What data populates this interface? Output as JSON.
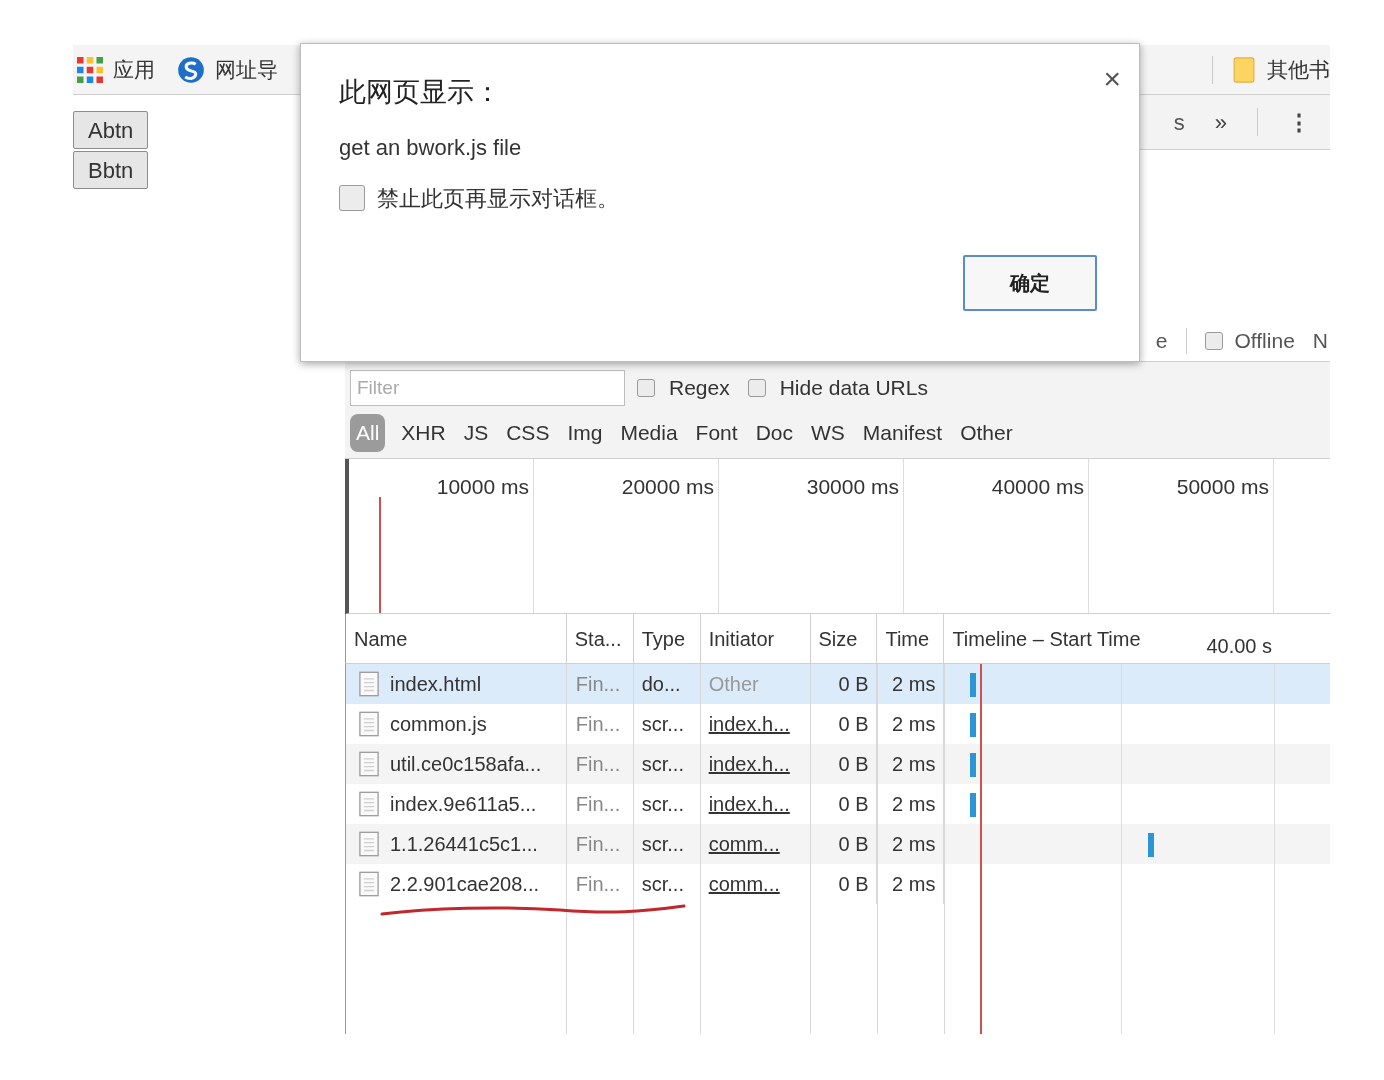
{
  "bookmarks_bar": {
    "items": [
      {
        "kind": "apps",
        "label": "应用"
      },
      {
        "kind": "site",
        "label": "网址导"
      }
    ],
    "other_bookmarks": "其他书"
  },
  "page_buttons": [
    "Abtn",
    "Bbtn"
  ],
  "devtools": {
    "top_toolbar": {
      "cut_tab": "s",
      "more": "»",
      "menu": "⋮"
    },
    "network_toolbar": {
      "cut_text": "e",
      "offline": {
        "label": "Offline",
        "checked": false
      },
      "cut_next": "N"
    },
    "filter": {
      "placeholder": "Filter",
      "regex": {
        "label": "Regex",
        "checked": false
      },
      "hide_data_urls": {
        "label": "Hide data URLs",
        "checked": false
      }
    },
    "type_filters": [
      {
        "label": "All",
        "selected": true
      },
      {
        "label": "XHR",
        "selected": false
      },
      {
        "label": "JS",
        "selected": false
      },
      {
        "label": "CSS",
        "selected": false
      },
      {
        "label": "Img",
        "selected": false
      },
      {
        "label": "Media",
        "selected": false
      },
      {
        "label": "Font",
        "selected": false
      },
      {
        "label": "Doc",
        "selected": false
      },
      {
        "label": "WS",
        "selected": false
      },
      {
        "label": "Manifest",
        "selected": false
      },
      {
        "label": "Other",
        "selected": false
      }
    ],
    "overview_ticks": [
      "10000 ms",
      "20000 ms",
      "30000 ms",
      "40000 ms",
      "50000 ms"
    ],
    "table": {
      "columns": [
        "Name",
        "Sta...",
        "Type",
        "Initiator",
        "Size",
        "Time",
        "Timeline – Start Time"
      ],
      "timeline_scale": "40.00 s",
      "rows": [
        {
          "name": "index.html",
          "status": "Fin...",
          "type": "do...",
          "initiator": "Other",
          "link": false,
          "size": "0 B",
          "time": "2 ms",
          "selected": true,
          "kind": "early"
        },
        {
          "name": "common.js",
          "status": "Fin...",
          "type": "scr...",
          "initiator": "index.h...",
          "link": true,
          "size": "0 B",
          "time": "2 ms",
          "selected": false,
          "kind": "early"
        },
        {
          "name": "util.ce0c158afa...",
          "status": "Fin...",
          "type": "scr...",
          "initiator": "index.h...",
          "link": true,
          "size": "0 B",
          "time": "2 ms",
          "selected": false,
          "kind": "early"
        },
        {
          "name": "index.9e611a5...",
          "status": "Fin...",
          "type": "scr...",
          "initiator": "index.h...",
          "link": true,
          "size": "0 B",
          "time": "2 ms",
          "selected": false,
          "kind": "early"
        },
        {
          "name": "1.1.26441c5c1...",
          "status": "Fin...",
          "type": "scr...",
          "initiator": "comm...",
          "link": true,
          "size": "0 B",
          "time": "2 ms",
          "selected": false,
          "kind": "late"
        },
        {
          "name": "2.2.901cae208...",
          "status": "Fin...",
          "type": "scr...",
          "initiator": "comm...",
          "link": true,
          "size": "0 B",
          "time": "2 ms",
          "selected": false,
          "kind": "nobar"
        }
      ]
    }
  },
  "dialog": {
    "title": "此网页显示：",
    "message": "get an bwork.js file",
    "suppress": {
      "label": "禁止此页再显示对话框。",
      "checked": false
    },
    "ok": "确定",
    "close": "×"
  }
}
